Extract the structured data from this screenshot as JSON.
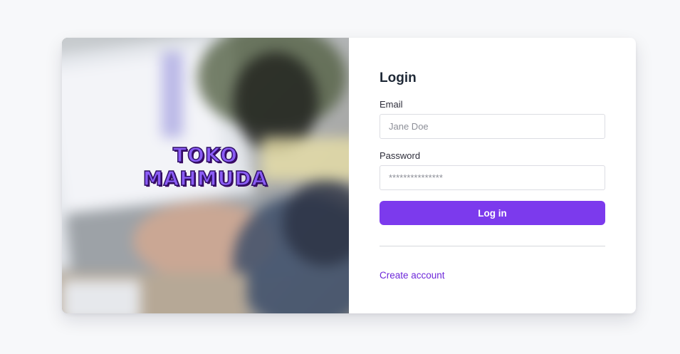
{
  "brand": {
    "line1": "TOKO",
    "line2": "MAHMUDA"
  },
  "login": {
    "title": "Login",
    "email_label": "Email",
    "email_placeholder": "Jane Doe",
    "password_label": "Password",
    "password_placeholder": "***************",
    "submit_label": "Log in",
    "create_account_label": "Create account"
  },
  "colors": {
    "accent": "#7c3aed",
    "link": "#6d28d9",
    "page_background": "#f7f8fa"
  }
}
